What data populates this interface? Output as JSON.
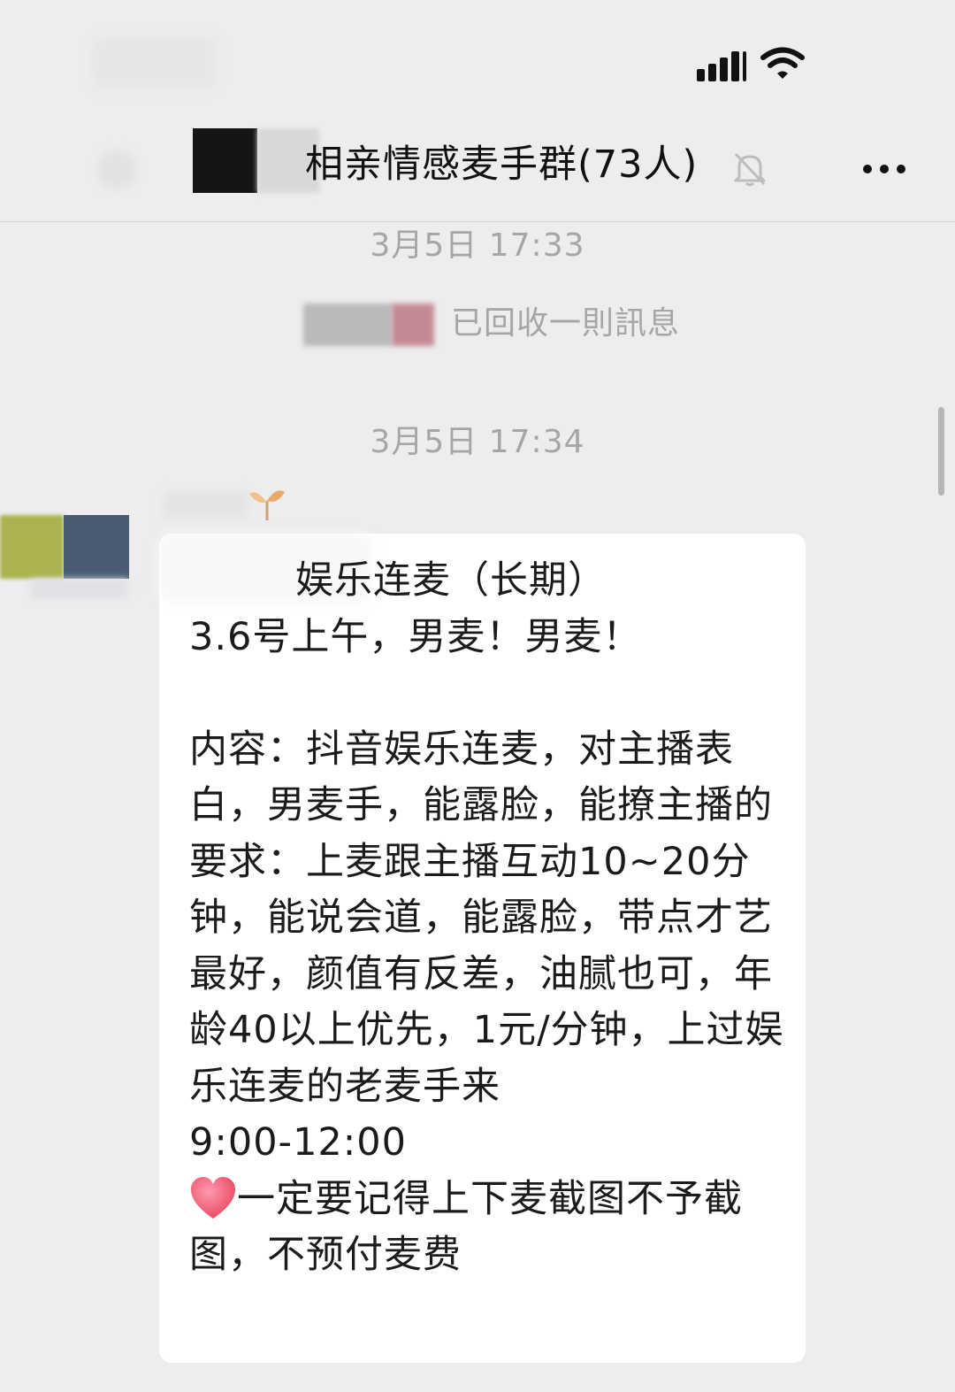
{
  "chat": {
    "title": "相亲情感麦手群(73人)"
  },
  "messages": {
    "timestamp_1": "3月5日 17:33",
    "recall_notice": "已回收一則訊息",
    "timestamp_2": "3月5日 17:34",
    "body_line_1": "娱乐连麦（长期）",
    "body_line_2": "3.6号上午，男麦！男麦！",
    "body_block_1": "内容：抖音娱乐连麦，对主播表白，男麦手，能露脸，能撩主播的",
    "body_block_2": "要求：上麦跟主播互动10~20分钟，能说会道，能露脸，带点才艺最好，颜值有反差，油腻也可，年龄40以上优先，1元/分钟，上过娱乐连麦的老麦手来",
    "body_time": "9:00-12:00",
    "body_note": "一定要记得上下麦截图不予截图，不预付麦费"
  },
  "icons": {
    "signal": "cellular-signal-icon",
    "wifi": "wifi-icon",
    "mute": "mute-bell-icon",
    "more": "more-dots-icon",
    "heart": "heart-emoji-icon",
    "sprout": "sprout-icon"
  },
  "colors": {
    "background": "#ededed",
    "bubble": "#ffffff",
    "timestamp_text": "#a6a6a6",
    "heart": "#f05a7a"
  }
}
